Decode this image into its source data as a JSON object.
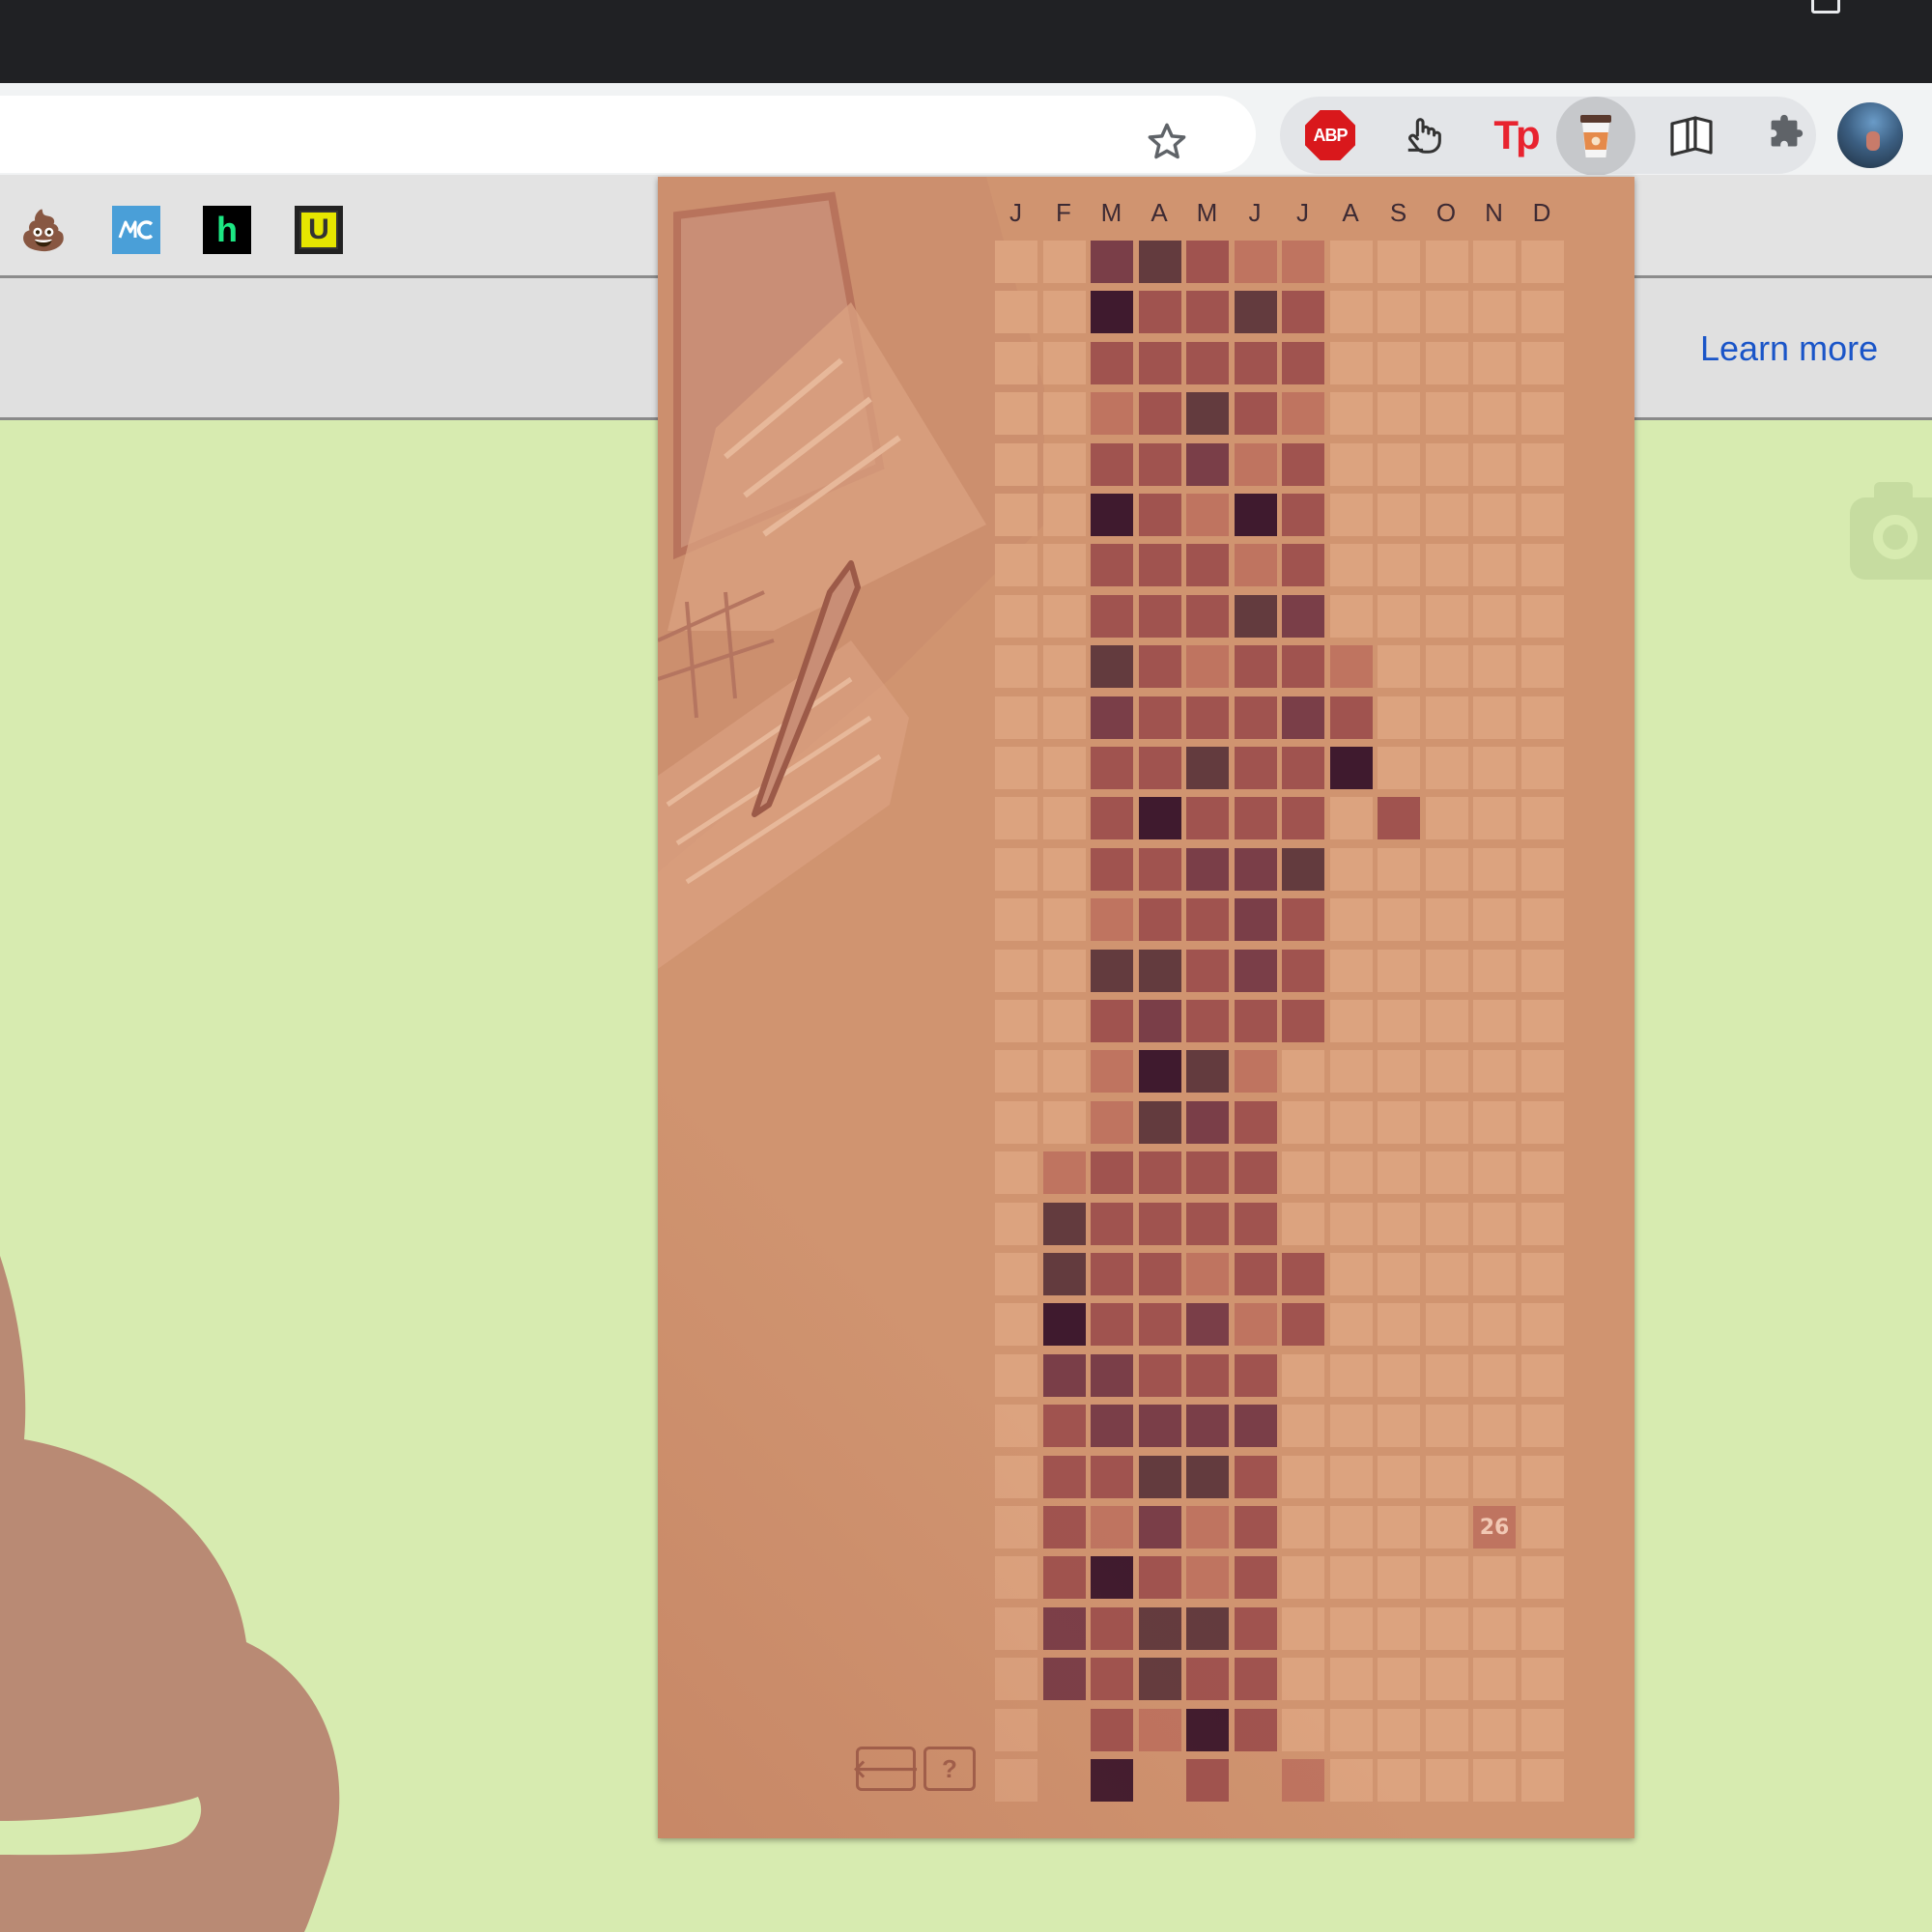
{
  "browser": {
    "infobar_link": "Learn more",
    "extensions": [
      {
        "name": "adblock-plus",
        "label": "ABP"
      },
      {
        "name": "hand-pointer",
        "label": ""
      },
      {
        "name": "tp-extension",
        "label": "Tp"
      },
      {
        "name": "coffee-cup",
        "label": ""
      },
      {
        "name": "book-reader",
        "label": ""
      },
      {
        "name": "extensions-puzzle",
        "label": ""
      }
    ],
    "bookmarks": [
      {
        "name": "poop-bookmark",
        "label": "💩"
      },
      {
        "name": "mc-bookmark",
        "label": "MC"
      },
      {
        "name": "hulu-bookmark",
        "label": "h"
      },
      {
        "name": "u-bookmark",
        "label": "U"
      }
    ]
  },
  "calendar": {
    "months": [
      "J",
      "F",
      "M",
      "A",
      "M",
      "J",
      "J",
      "A",
      "S",
      "O",
      "N",
      "D"
    ],
    "today_label": "26",
    "back_label": "🡐",
    "help_label": "?",
    "palette": {
      "0": "#dca37f",
      "1": "#bf7460",
      "2": "#a0534f",
      "3": "#7a3e48",
      "4": "#633b3e",
      "5": "#3f1a2e",
      "x": "#d09470"
    },
    "days": [
      [
        0,
        0,
        3,
        4,
        2,
        1,
        1,
        0,
        0,
        0,
        0,
        0
      ],
      [
        0,
        0,
        5,
        2,
        2,
        4,
        2,
        0,
        0,
        0,
        0,
        0
      ],
      [
        0,
        0,
        2,
        2,
        2,
        2,
        2,
        0,
        0,
        0,
        0,
        0
      ],
      [
        0,
        0,
        1,
        2,
        4,
        2,
        1,
        0,
        0,
        0,
        0,
        0
      ],
      [
        0,
        0,
        2,
        2,
        3,
        1,
        2,
        0,
        0,
        0,
        0,
        0
      ],
      [
        0,
        0,
        5,
        2,
        1,
        5,
        2,
        0,
        0,
        0,
        0,
        0
      ],
      [
        0,
        0,
        2,
        2,
        2,
        1,
        2,
        0,
        0,
        0,
        0,
        0
      ],
      [
        0,
        0,
        2,
        2,
        2,
        4,
        3,
        0,
        0,
        0,
        0,
        0
      ],
      [
        0,
        0,
        4,
        2,
        1,
        2,
        2,
        1,
        0,
        0,
        0,
        0
      ],
      [
        0,
        0,
        3,
        2,
        2,
        2,
        3,
        2,
        0,
        0,
        0,
        0
      ],
      [
        0,
        0,
        2,
        2,
        4,
        2,
        2,
        5,
        0,
        0,
        0,
        0
      ],
      [
        0,
        0,
        2,
        5,
        2,
        2,
        2,
        0,
        2,
        0,
        0,
        0
      ],
      [
        0,
        0,
        2,
        2,
        3,
        3,
        4,
        0,
        0,
        0,
        0,
        0
      ],
      [
        0,
        0,
        1,
        2,
        2,
        3,
        2,
        0,
        0,
        0,
        0,
        0
      ],
      [
        0,
        0,
        4,
        4,
        2,
        3,
        2,
        0,
        0,
        0,
        0,
        0
      ],
      [
        0,
        0,
        2,
        3,
        2,
        2,
        2,
        0,
        0,
        0,
        0,
        0
      ],
      [
        0,
        0,
        1,
        5,
        4,
        1,
        0,
        0,
        0,
        0,
        0,
        0
      ],
      [
        0,
        0,
        1,
        4,
        3,
        2,
        0,
        0,
        0,
        0,
        0,
        0
      ],
      [
        0,
        1,
        2,
        2,
        2,
        2,
        0,
        0,
        0,
        0,
        0,
        0
      ],
      [
        0,
        4,
        2,
        2,
        2,
        2,
        0,
        0,
        0,
        0,
        0,
        0
      ],
      [
        0,
        4,
        2,
        2,
        1,
        2,
        2,
        0,
        0,
        0,
        0,
        0
      ],
      [
        0,
        5,
        2,
        2,
        3,
        1,
        2,
        0,
        0,
        0,
        0,
        0
      ],
      [
        0,
        3,
        3,
        2,
        2,
        2,
        0,
        0,
        0,
        0,
        0,
        0
      ],
      [
        0,
        2,
        3,
        3,
        3,
        3,
        0,
        0,
        0,
        0,
        0,
        0
      ],
      [
        0,
        2,
        2,
        4,
        4,
        2,
        0,
        0,
        0,
        0,
        0,
        0
      ],
      [
        0,
        2,
        1,
        3,
        1,
        2,
        0,
        0,
        0,
        0,
        "t",
        0
      ],
      [
        0,
        2,
        5,
        2,
        1,
        2,
        0,
        0,
        0,
        0,
        0,
        0
      ],
      [
        0,
        3,
        2,
        4,
        4,
        2,
        0,
        0,
        0,
        0,
        0,
        0
      ],
      [
        0,
        3,
        2,
        4,
        2,
        2,
        0,
        0,
        0,
        0,
        0,
        0
      ],
      [
        0,
        "x",
        2,
        1,
        5,
        2,
        0,
        0,
        0,
        0,
        0,
        0
      ],
      [
        0,
        "x",
        5,
        "x",
        2,
        "x",
        1,
        0,
        0,
        0,
        0,
        0
      ]
    ]
  }
}
